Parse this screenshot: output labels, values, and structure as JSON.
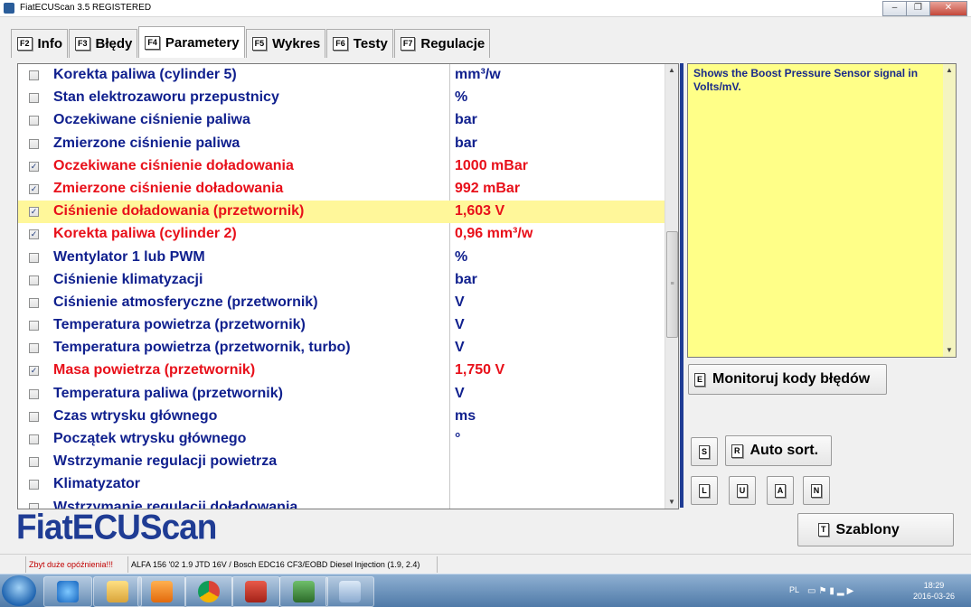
{
  "window": {
    "title": "FiatECUScan 3.5 REGISTERED",
    "minimize": "–",
    "maximize": "❐",
    "close": "✕"
  },
  "tabs": [
    {
      "key": "F2",
      "label": "Info"
    },
    {
      "key": "F3",
      "label": "Błędy"
    },
    {
      "key": "F4",
      "label": "Parametery"
    },
    {
      "key": "F5",
      "label": "Wykres"
    },
    {
      "key": "F6",
      "label": "Testy"
    },
    {
      "key": "F7",
      "label": "Regulacje"
    }
  ],
  "params": [
    {
      "name": "Korekta paliwa (cylinder 5)",
      "value": "mm³/w",
      "checked": false
    },
    {
      "name": "Stan elektrozaworu przepustnicy",
      "value": "%",
      "checked": false
    },
    {
      "name": "Oczekiwane ciśnienie paliwa",
      "value": "bar",
      "checked": false
    },
    {
      "name": "Zmierzone ciśnienie paliwa",
      "value": "bar",
      "checked": false
    },
    {
      "name": "Oczekiwane ciśnienie doładowania",
      "value": "1000 mBar",
      "checked": true
    },
    {
      "name": "Zmierzone ciśnienie doładowania",
      "value": "992 mBar",
      "checked": true
    },
    {
      "name": "Ciśnienie doładowania (przetwornik)",
      "value": "1,603 V",
      "checked": true,
      "selected": true
    },
    {
      "name": "Korekta paliwa (cylinder 2)",
      "value": "0,96 mm³/w",
      "checked": true
    },
    {
      "name": "Wentylator 1 lub PWM",
      "value": "%",
      "checked": false
    },
    {
      "name": "Ciśnienie klimatyzacji",
      "value": "bar",
      "checked": false
    },
    {
      "name": "Ciśnienie atmosferyczne (przetwornik)",
      "value": "V",
      "checked": false
    },
    {
      "name": "Temperatura powietrza (przetwornik)",
      "value": "V",
      "checked": false
    },
    {
      "name": "Temperatura powietrza (przetwornik, turbo)",
      "value": "V",
      "checked": false
    },
    {
      "name": "Masa powietrza (przetwornik)",
      "value": "1,750 V",
      "checked": true
    },
    {
      "name": "Temperatura paliwa (przetwornik)",
      "value": "V",
      "checked": false
    },
    {
      "name": "Czas wtrysku głównego",
      "value": "ms",
      "checked": false
    },
    {
      "name": "Początek wtrysku głównego",
      "value": "°",
      "checked": false
    },
    {
      "name": "Wstrzymanie regulacji powietrza",
      "value": "",
      "checked": false
    },
    {
      "name": "Klimatyzator",
      "value": "",
      "checked": false
    },
    {
      "name": "Wstrzymanie regulacji doładowania",
      "value": "",
      "checked": false
    }
  ],
  "description": "Shows the Boost Pressure Sensor signal in Volts/mV.",
  "buttons": {
    "monitor": {
      "key": "E",
      "label": "Monitoruj kody błędów"
    },
    "s": {
      "key": "S"
    },
    "autosort": {
      "key": "R",
      "label": "Auto sort."
    },
    "l": {
      "key": "L"
    },
    "u": {
      "key": "U"
    },
    "a": {
      "key": "A"
    },
    "n": {
      "key": "N"
    },
    "templates": {
      "key": "T",
      "label": "Szablony"
    }
  },
  "logo": "FiatECUScan",
  "status": {
    "warning": "Zbyt duże opóźnienia!!!",
    "vehicle": "ALFA 156 '02 1.9 JTD 16V / Bosch EDC16 CF3/EOBD Diesel Injection (1.9, 2.4)"
  },
  "taskbar": {
    "lang": "PL",
    "time": "18:29",
    "date": "2016-03-26",
    "apps": [
      "internet-explorer-icon",
      "file-explorer-icon",
      "media-player-icon",
      "chrome-icon",
      "toolbox-icon",
      "ecu-scan-icon",
      "paint-icon"
    ]
  }
}
